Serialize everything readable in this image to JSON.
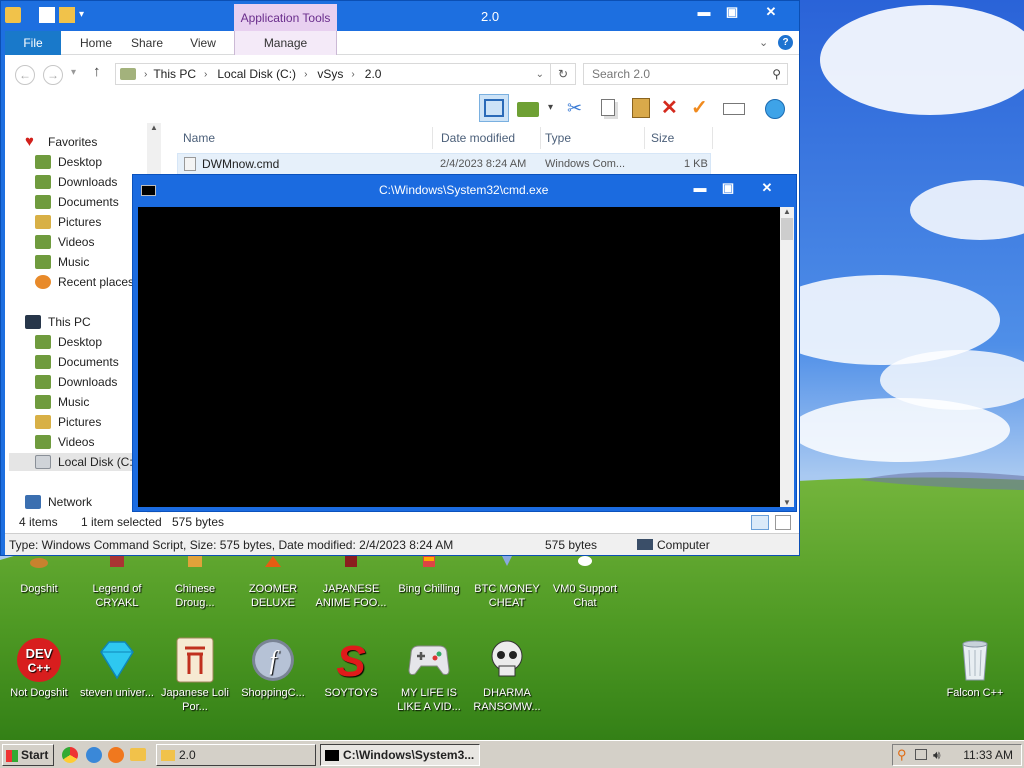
{
  "desktop": {
    "icons_row1": [
      {
        "label": "Dogshit"
      },
      {
        "label": "Legend of CRYAKL"
      },
      {
        "label": "Chinese Droug..."
      },
      {
        "label": "ZOOMER DELUXE"
      },
      {
        "label": "JAPANESE ANIME FOO..."
      },
      {
        "label": "Bing Chilling"
      },
      {
        "label": "BTC MONEY CHEAT"
      },
      {
        "label": "VM0 Support Chat"
      }
    ],
    "icons_row2": [
      {
        "label": "Not Dogshit"
      },
      {
        "label": "steven univer..."
      },
      {
        "label": "Japanese Loli Por..."
      },
      {
        "label": "ShoppingC..."
      },
      {
        "label": "SOYTOYS"
      },
      {
        "label": "MY LIFE IS LIKE A VID..."
      },
      {
        "label": "DHARMA RANSOMW..."
      }
    ],
    "recycle": {
      "label": "Falcon C++"
    }
  },
  "explorer": {
    "title": "2.0",
    "app_tools": "Application Tools",
    "tabs": {
      "file": "File",
      "home": "Home",
      "share": "Share",
      "view": "View",
      "manage": "Manage"
    },
    "address": [
      "This PC",
      "Local Disk (C:)",
      "vSys",
      "2.0"
    ],
    "search_placeholder": "Search 2.0",
    "columns": {
      "name": "Name",
      "date": "Date modified",
      "type": "Type",
      "size": "Size"
    },
    "file": {
      "name": "DWMnow.cmd",
      "date": "2/4/2023 8:24 AM",
      "type": "Windows Com...",
      "size": "1 KB"
    },
    "nav": {
      "favorites": "Favorites",
      "fav_items": [
        "Desktop",
        "Downloads",
        "Documents",
        "Pictures",
        "Videos",
        "Music",
        "Recent places"
      ],
      "this_pc": "This PC",
      "pc_items": [
        "Desktop",
        "Documents",
        "Downloads",
        "Music",
        "Pictures",
        "Videos",
        "Local Disk (C:)"
      ],
      "network": "Network"
    },
    "status": {
      "items": "4 items",
      "selected": "1 item selected",
      "bytes": "575 bytes"
    },
    "details": {
      "text": "Type: Windows Command Script, Size: 575 bytes, Date modified: 2/4/2023 8:24 AM",
      "size": "575 bytes",
      "location": "Computer"
    }
  },
  "cmd": {
    "title": "C:\\Windows\\System32\\cmd.exe"
  },
  "taskbar": {
    "start": "Start",
    "tasks": [
      "2.0",
      "C:\\Windows\\System3..."
    ],
    "clock": "11:33 AM"
  },
  "colors": {
    "accent": "#1d6fe0",
    "cmd_bg": "#000000"
  }
}
